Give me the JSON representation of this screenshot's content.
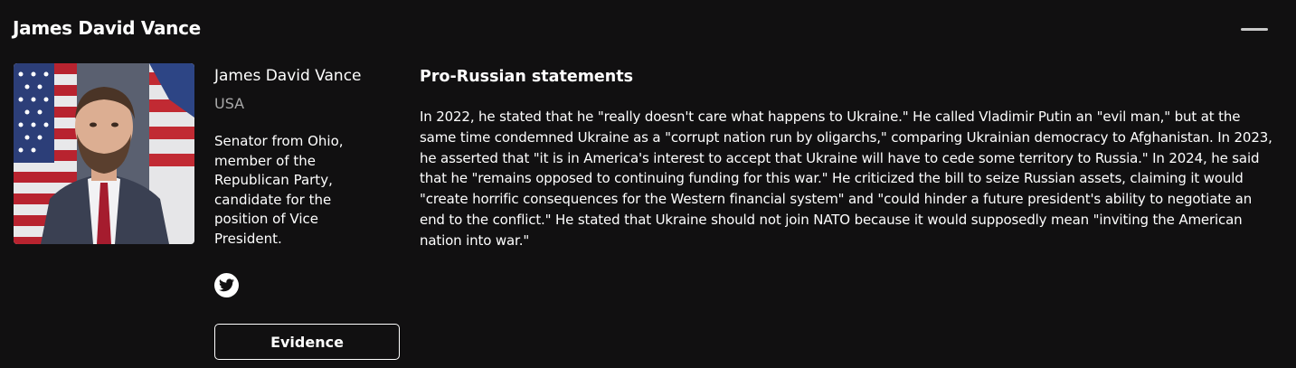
{
  "header": {
    "title": "James David Vance"
  },
  "profile": {
    "photo_icon": "portrait-photo",
    "name": "James David Vance",
    "country": "USA",
    "role": "Senator from Ohio, member of the Republican Party, candidate for the position of Vice President.",
    "social_icon": "twitter-icon",
    "evidence_label": "Evidence"
  },
  "statements": {
    "title": "Pro-Russian statements",
    "text": "In 2022, he stated that he \"really doesn't care what happens to Ukraine.\" He called Vladimir Putin an \"evil man,\" but at the same time condemned Ukraine as a \"corrupt nation run by oligarchs,\" comparing Ukrainian democracy to Afghanistan. In 2023, he asserted that \"it is in America's interest to accept that Ukraine will have to cede some territory to Russia.\" In 2024, he said that he \"remains opposed to continuing funding for this war.\" He criticized the bill to seize Russian assets, claiming it would \"create horrific consequences for the Western financial system\" and \"could hinder a future president's ability to negotiate an end to the conflict.\" He stated that Ukraine should not join NATO because it would supposedly mean \"inviting the American nation into war.\""
  },
  "colors": {
    "background": "#111011",
    "text": "#ffffff",
    "muted": "#a9a9a9"
  }
}
